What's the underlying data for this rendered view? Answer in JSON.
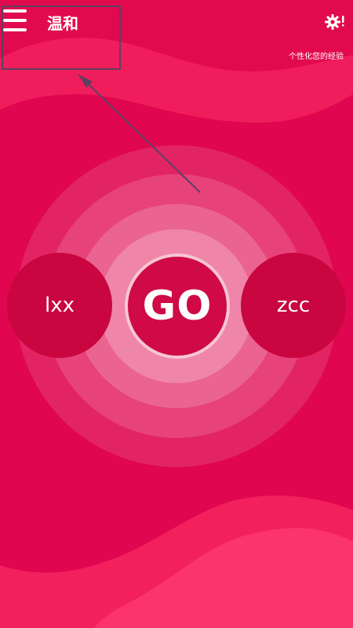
{
  "header": {
    "title": "温和",
    "menu_icon": "hamburger-menu-icon",
    "settings_icon": "gear-icon"
  },
  "personalize_label": "个性化您的经验",
  "players": {
    "left": "lxx",
    "right": "zcc"
  },
  "go_label": "GO",
  "colors": {
    "background": "#e0064f",
    "player_circle": "#c90640",
    "ring_light": "#f9c8d6",
    "text": "#ffffff"
  }
}
